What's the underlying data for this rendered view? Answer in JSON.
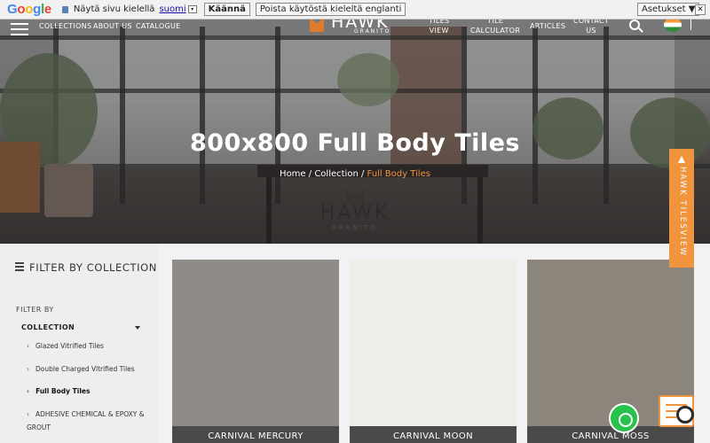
{
  "translate_bar": {
    "logo": [
      "G",
      "o",
      "o",
      "g",
      "l",
      "e"
    ],
    "prompt": "Näytä sivu kielellä",
    "language": "suomi",
    "translate_button": "Käännä",
    "disable_button": "Poista käytöstä kieleltä englanti",
    "settings_button": "Asetukset ▼",
    "close": "✕"
  },
  "nav": {
    "items": [
      "COLLECTIONS",
      "ABOUT US",
      "CATALOGUE"
    ],
    "logo_text": "HAWK",
    "logo_sub": "GRANITO",
    "right_items": [
      "TILES\nVIEW",
      "TILE\nCALCULATOR",
      "ARTICLES",
      "CONTACT\nUS"
    ]
  },
  "hero": {
    "title": "800x800 Full Body Tiles",
    "breadcrumb": {
      "home": "Home",
      "sep1": " / ",
      "collection": "Collection",
      "sep2": " / ",
      "current": "Full Body Tiles"
    },
    "watermark": "HAWK",
    "watermark_sub": "GRANITO"
  },
  "side_tab": {
    "label": "HAWK TILESVIEW"
  },
  "sidebar": {
    "heading": "FILTER BY COLLECTION",
    "filter_by": "FILTER BY",
    "collection_label": "COLLECTION",
    "items": [
      {
        "label": "Glazed Vitrified Tiles",
        "active": false
      },
      {
        "label": "Double Charged Vitrified Tiles",
        "active": false
      },
      {
        "label": "Full Body Tiles",
        "active": true
      },
      {
        "label": "ADHESIVE CHEMICAL & EPOXY & GROUT",
        "active": false
      }
    ]
  },
  "products": [
    {
      "name": "CARNIVAL MERCURY",
      "color": "#8f8b86"
    },
    {
      "name": "CARNIVAL MOON",
      "color": "#efede8"
    },
    {
      "name": "CARNIVAL MOSS",
      "color": "#8c857c"
    }
  ],
  "colors": {
    "accent": "#f0953e",
    "label_bg": "#4a4a4a",
    "whatsapp": "#27c24c"
  },
  "icons": [
    "hamburger-icon",
    "search-icon",
    "flag-icon",
    "list-icon",
    "caret-icon",
    "chevron-right-icon",
    "whatsapp-icon",
    "chat-icon"
  ]
}
